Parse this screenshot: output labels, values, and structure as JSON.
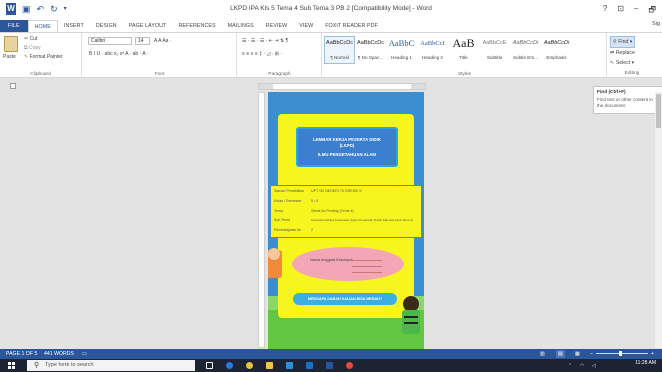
{
  "window": {
    "title": "LKPD IPA Kls 5 Tema 4 Sub Tema 3 PB 2 [Compatibility Mode] - Word",
    "controls": [
      "?",
      "⊡",
      "–",
      "🗗"
    ]
  },
  "quick_access": [
    "save-icon",
    "undo-icon",
    "redo-icon",
    "customize-icon"
  ],
  "tabs": [
    "FILE",
    "HOME",
    "INSERT",
    "DESIGN",
    "PAGE LAYOUT",
    "REFERENCES",
    "MAILINGS",
    "REVIEW",
    "VIEW",
    "FOXIT READER PDF"
  ],
  "active_tab": "HOME",
  "signin": "Sig",
  "ribbon": {
    "clipboard": {
      "label": "Clipboard",
      "cut": "Cut",
      "copy": "Copy",
      "paste": "Paste",
      "format_painter": "Format Painter"
    },
    "font": {
      "label": "Font",
      "name": "Calibri",
      "size": "14",
      "row1_tools": "A A Aa ·",
      "row2_tools": "B I U · abc x₂ x² A · ab · A ·"
    },
    "paragraph": {
      "label": "Paragraph",
      "row1_tools": "☰ · ☰ · ☰ · ⇤ ⇥ ⇅ ¶",
      "row2_tools": "≡ ≡ ≡ ≡ ‡ · ◿ · ⊞ ·"
    },
    "styles": {
      "label": "Styles",
      "items": [
        {
          "sample": "AaBbCcDc",
          "name": "¶ Normal",
          "selected": true
        },
        {
          "sample": "AaBbCcDc",
          "name": "¶ No Spac..."
        },
        {
          "sample": "AaBbC",
          "name": "Heading 1"
        },
        {
          "sample": "AaBbCcI",
          "name": "Heading 2"
        },
        {
          "sample": "AaB",
          "name": "Title"
        },
        {
          "sample": "AaBbCcE",
          "name": "Subtitle"
        },
        {
          "sample": "AaBbCcDi",
          "name": "Subtle Em..."
        },
        {
          "sample": "AaBbCcDi",
          "name": "Emphasis"
        }
      ]
    },
    "editing": {
      "label": "Editing",
      "find": "Find",
      "replace": "Replace",
      "select": "Select"
    }
  },
  "tooltip": {
    "title": "Find (Ctrl+F)",
    "body": "Find text or other content in the document."
  },
  "document": {
    "header_lines": [
      "LEMBAR KERJA PESERTA DIDIK",
      "(LKPD)",
      "ILMU PENGETAHUAN ALAM"
    ],
    "info_rows": [
      {
        "label": "Satuan Pendidikan",
        "value": "UPT SD NEGERI 70 GRESIK II"
      },
      {
        "label": "Kelas / Semester",
        "value": "5 / II"
      },
      {
        "label": "Tema",
        "value": "Sehat Itu Penting (Tema 4)"
      },
      {
        "label": "Sub Tema",
        "value": "Cara Memelihara Kesehatan Organ Peredaran Darah Manusia (Sub Tema 3)"
      },
      {
        "label": "Pembelajaran ke",
        "value": "2"
      }
    ],
    "pink_label": "Nama Anggota Kelompok",
    "button_text": "MENGAPA DARAH KALIAN BISA MERAH?"
  },
  "statusbar": {
    "page": "PAGE 1 OF 5",
    "words": "441 WORDS",
    "proofing_icon": "proofing-icon",
    "views": [
      "read-mode-icon",
      "print-layout-icon",
      "web-layout-icon"
    ],
    "zoom_minus": "–",
    "zoom_plus": "+"
  },
  "taskbar": {
    "search_placeholder": "Type here to search",
    "time": "11:28 AM",
    "apps": [
      "task-view-icon",
      "edge-icon",
      "chrome-icon",
      "file-explorer-icon",
      "store-icon",
      "mail-icon",
      "word-icon",
      "chrome2-icon"
    ],
    "colors": [
      "#ffffff",
      "#2a7ae2",
      "#e8c040",
      "#f2c744",
      "#2f8ed8",
      "#1f6fc0",
      "#2b579a",
      "#e64a3b"
    ]
  },
  "colors": {
    "accent": "#2b579a",
    "page_bg": "#3b8fd0",
    "yellow": "#f6f61e"
  }
}
